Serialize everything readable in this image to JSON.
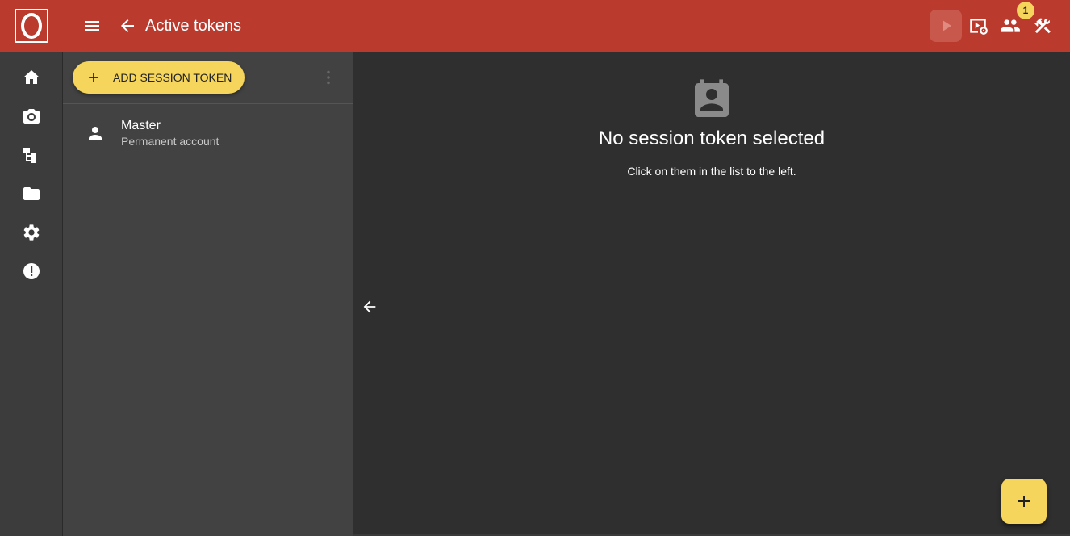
{
  "header": {
    "title": "Active tokens",
    "notification_count": "1",
    "brand_color": "#ba3b2e",
    "accent_color": "#f6d55c",
    "icons": [
      "logo",
      "menu-icon",
      "back-arrow-icon",
      "play-icon",
      "preview-settings-icon",
      "users-icon",
      "tools-icon"
    ]
  },
  "rail": {
    "items": [
      {
        "icon": "home-icon"
      },
      {
        "icon": "camera-icon"
      },
      {
        "icon": "hierarchy-icon"
      },
      {
        "icon": "folder-icon"
      },
      {
        "icon": "gear-icon"
      },
      {
        "icon": "alert-icon"
      }
    ]
  },
  "list": {
    "add_label": "ADD SESSION TOKEN",
    "items": [
      {
        "title": "Master",
        "subtitle": "Permanent account",
        "icon": "person-icon"
      }
    ]
  },
  "detail": {
    "empty_title": "No session token selected",
    "empty_subtitle": "Click on them in the list to the left."
  }
}
